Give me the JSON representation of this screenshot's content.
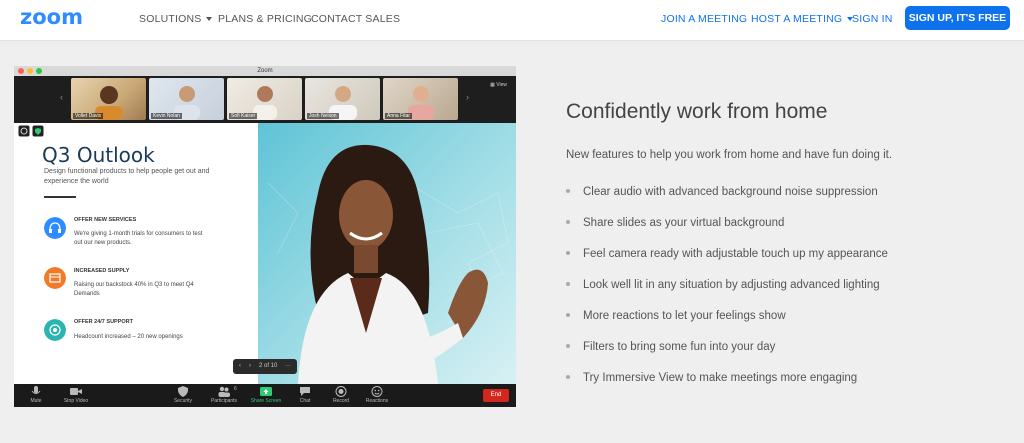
{
  "nav": {
    "logo": "zoom",
    "solutions": "SOLUTIONS",
    "plans": "PLANS & PRICING",
    "contact": "CONTACT SALES",
    "join": "JOIN A MEETING",
    "host": "HOST A MEETING",
    "signin": "SIGN IN",
    "signup": "SIGN UP, IT'S FREE",
    "accent_color": "#0e72ed"
  },
  "window": {
    "title": "Zoom",
    "view_label": "View",
    "participants": [
      {
        "name": "Vollet Davis"
      },
      {
        "name": "Kevin Nolan"
      },
      {
        "name": "Sofi Kaiser"
      },
      {
        "name": "Josh Nelson"
      },
      {
        "name": "Anna Fitar"
      }
    ],
    "slide": {
      "title": "Q3 Outlook",
      "subtitle": "Design functional products to help people get out and experience the world",
      "items": [
        {
          "heading": "OFFER NEW SERVICES",
          "text": "We're giving 1-month trials for consumers to test out our new products.",
          "icon": "headphones-icon",
          "color": "#2d8cff"
        },
        {
          "heading": "INCREASED SUPPLY",
          "text": "Raising our backstock 40% in Q3 to meet Q4 Demands",
          "icon": "box-icon",
          "color": "#f07a2a"
        },
        {
          "heading": "OFFER 24/7 SUPPORT",
          "text": "Headcount increased – 20 new openings",
          "icon": "support-icon",
          "color": "#2bb5b0"
        }
      ]
    },
    "pager": "2 of 10",
    "toolbar": {
      "mute": "Mute",
      "stop_video": "Stop Video",
      "security": "Security",
      "participants": "Participants",
      "participants_count": "6",
      "share_screen": "Share Screen",
      "chat": "Chat",
      "record": "Record",
      "reactions": "Reactions",
      "end": "End"
    }
  },
  "content": {
    "heading": "Confidently work from home",
    "intro": "New features to help you work from home and have fun doing it.",
    "features": [
      "Clear audio with advanced background noise suppression",
      "Share slides as your virtual background",
      "Feel camera ready with adjustable touch up my appearance",
      "Look well lit in any situation by adjusting advanced lighting",
      "More reactions to let your feelings show",
      "Filters to bring some fun into your day",
      "Try Immersive View to make meetings more engaging"
    ]
  }
}
